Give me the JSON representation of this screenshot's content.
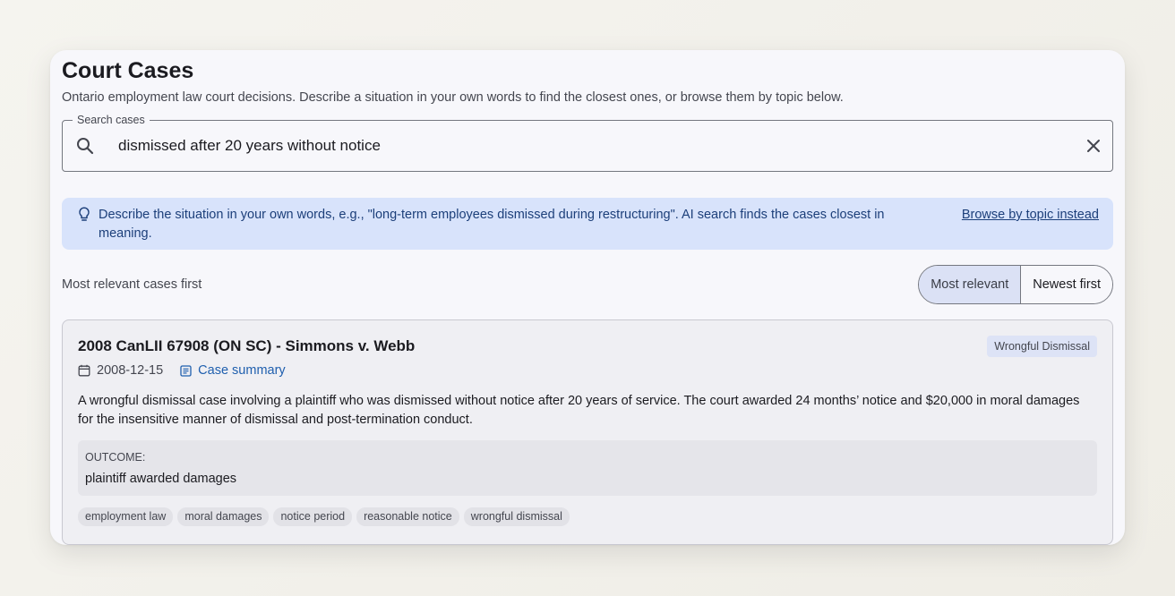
{
  "page": {
    "title": "Court Cases",
    "subtitle": "Ontario employment law court decisions. Describe a situation in your own words to find the closest ones, or browse them by topic below."
  },
  "search": {
    "legend": "Search cases",
    "value": "dismissed after 20 years without notice",
    "icon": "search-icon",
    "clear_icon": "close-icon"
  },
  "hint": {
    "icon": "lightbulb-icon",
    "text": "Describe the situation in your own words, e.g., \"long-term employees dismissed during restructuring\". AI search finds the cases closest in meaning.",
    "link": "Browse by topic instead"
  },
  "sort": {
    "label": "Most relevant cases first",
    "options": [
      "Most relevant",
      "Newest first"
    ],
    "selected": "Most relevant"
  },
  "cases": [
    {
      "title": "2008 CanLII 67908 (ON SC) - Simmons v. Webb",
      "topic": "Wrongful Dismissal",
      "date": "2008-12-15",
      "summary_link": "Case summary",
      "description": "A wrongful dismissal case involving a plaintiff who was dismissed without notice after 20 years of service. The court awarded 24 months’ notice and $20,000 in moral damages for the insensitive manner of dismissal and post-termination conduct.",
      "outcome_label": "OUTCOME:",
      "outcome": "plaintiff awarded damages",
      "tags": [
        "employment law",
        "moral damages",
        "notice period",
        "reasonable notice",
        "wrongful dismissal"
      ]
    }
  ],
  "colors": {
    "banner_bg": "#d8e3fb",
    "banner_text": "#1c3f7a",
    "link": "#1f5fae",
    "toggle_active_bg": "#dbe1f5"
  }
}
